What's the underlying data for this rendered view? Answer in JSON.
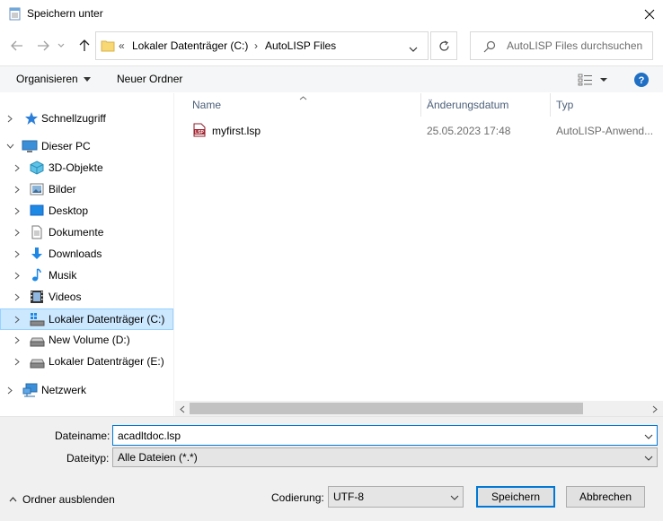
{
  "window": {
    "title": "Speichern unter"
  },
  "address": {
    "overflow": "«",
    "crumbs": [
      "Lokaler Datenträger (C:)",
      "AutoLISP Files"
    ]
  },
  "search": {
    "placeholder": "AutoLISP Files durchsuchen"
  },
  "toolbar": {
    "organize_label": "Organisieren",
    "new_folder_label": "Neuer Ordner"
  },
  "navpane": {
    "quick_access": "Schnellzugriff",
    "this_pc": "Dieser PC",
    "items": [
      {
        "label": "3D-Objekte",
        "icon": "3d-objects-icon"
      },
      {
        "label": "Bilder",
        "icon": "pictures-icon"
      },
      {
        "label": "Desktop",
        "icon": "desktop-icon"
      },
      {
        "label": "Dokumente",
        "icon": "documents-icon"
      },
      {
        "label": "Downloads",
        "icon": "downloads-icon"
      },
      {
        "label": "Musik",
        "icon": "music-icon"
      },
      {
        "label": "Videos",
        "icon": "videos-icon"
      },
      {
        "label": "Lokaler Datenträger (C:)",
        "icon": "drive-c-icon"
      },
      {
        "label": "New Volume (D:)",
        "icon": "drive-icon"
      },
      {
        "label": "Lokaler Datenträger (E:)",
        "icon": "drive-icon"
      }
    ],
    "network": "Netzwerk"
  },
  "filelist": {
    "columns": [
      "Name",
      "Änderungsdatum",
      "Typ"
    ],
    "files": [
      {
        "name": "myfirst.lsp",
        "date": "25.05.2023 17:48",
        "type": "AutoLISP-Anwend..."
      }
    ]
  },
  "form": {
    "filename_label": "Dateiname:",
    "filename_value": "acadltdoc.lsp",
    "filetype_label": "Dateityp:",
    "filetype_value": "Alle Dateien  (*.*)",
    "encoding_label": "Codierung:",
    "encoding_value": "UTF-8",
    "save_label": "Speichern",
    "cancel_label": "Abbrechen",
    "hide_folders_label": "Ordner ausblenden"
  },
  "colors": {
    "accent": "#0078d7",
    "selection": "#cce8ff",
    "help": "#1f6fc5"
  }
}
